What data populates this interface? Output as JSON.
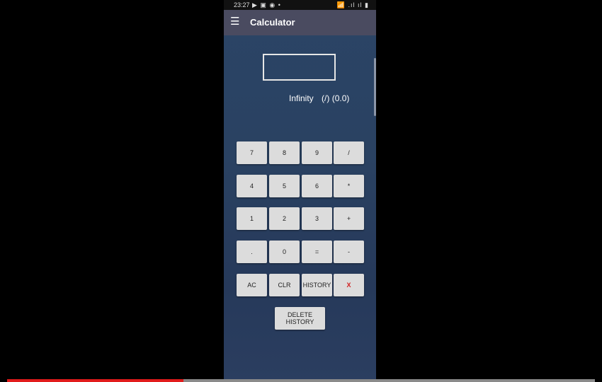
{
  "status_bar": {
    "time": "23:27",
    "left_icons": "▶ ▣ ◉ •",
    "right_icons": "📶 .ıl ıl ▮"
  },
  "app_bar": {
    "menu_icon": "hamburger-menu-icon",
    "title": "Calculator"
  },
  "display": {
    "value": ""
  },
  "result": {
    "value": "Infinity",
    "expression": "(/) (0.0)"
  },
  "keypad": {
    "rows": [
      [
        "7",
        "8",
        "9",
        "/"
      ],
      [
        "4",
        "5",
        "6",
        "*"
      ],
      [
        "1",
        "2",
        "3",
        "+"
      ],
      [
        ".",
        "0",
        "=",
        "-"
      ],
      [
        "AC",
        "CLR",
        "HISTORY",
        "X"
      ]
    ],
    "delete_history": "DELETE HISTORY"
  },
  "video_progress": {
    "fraction": 0.3,
    "fill_color": "#e11b1b",
    "track_color": "#8a8a8a"
  },
  "colors": {
    "app_bar": "#4a4b60",
    "background": "#2b4466",
    "key": "#dcdcdc",
    "x_key_text": "#d11c1c"
  }
}
